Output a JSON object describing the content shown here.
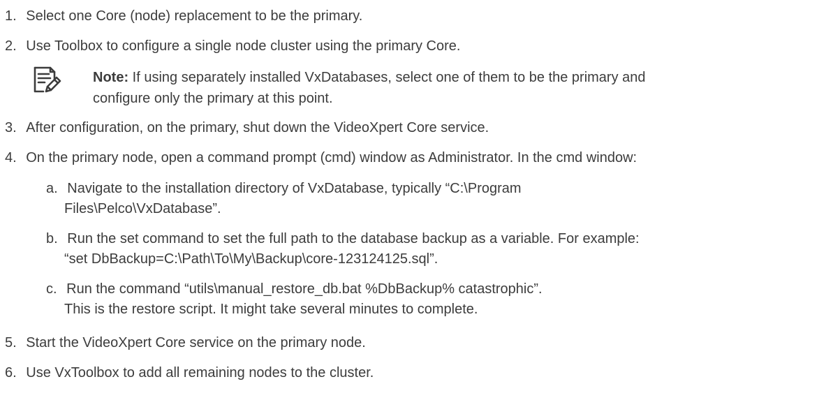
{
  "steps": [
    {
      "num": "1.",
      "text": "Select one Core (node) replacement to be the primary."
    },
    {
      "num": "2.",
      "text": "Use Toolbox to configure a single node cluster using the primary Core."
    },
    {
      "num": "3.",
      "text": "After configuration, on the primary, shut down the VideoXpert Core service."
    },
    {
      "num": "4.",
      "text": "On the primary node, open a command prompt (cmd) window as Administrator. In the cmd window:"
    },
    {
      "num": "5.",
      "text": "Start the VideoXpert Core service on the primary node."
    },
    {
      "num": "6.",
      "text": "Use VxToolbox to add all remaining nodes to the cluster."
    }
  ],
  "note": {
    "icon": "note-icon",
    "label": "Note:",
    "line1": " If using separately installed VxDatabases, select one of them to be the primary and",
    "line2": "configure only the primary at this point."
  },
  "substeps": [
    {
      "letter": "a.",
      "line1": "Navigate to the installation directory of VxDatabase, typically “C:\\Program",
      "line2": "Files\\Pelco\\VxDatabase”."
    },
    {
      "letter": "b.",
      "line1": "Run the set command to set the full path to the database backup as a variable. For example:",
      "line2": "“set DbBackup=C:\\Path\\To\\My\\Backup\\core-123124125.sql”."
    },
    {
      "letter": "c.",
      "line1": "Run the command “utils\\manual_restore_db.bat %DbBackup% catastrophic”.",
      "line2": "This is the restore script. It might take several minutes to complete."
    }
  ]
}
